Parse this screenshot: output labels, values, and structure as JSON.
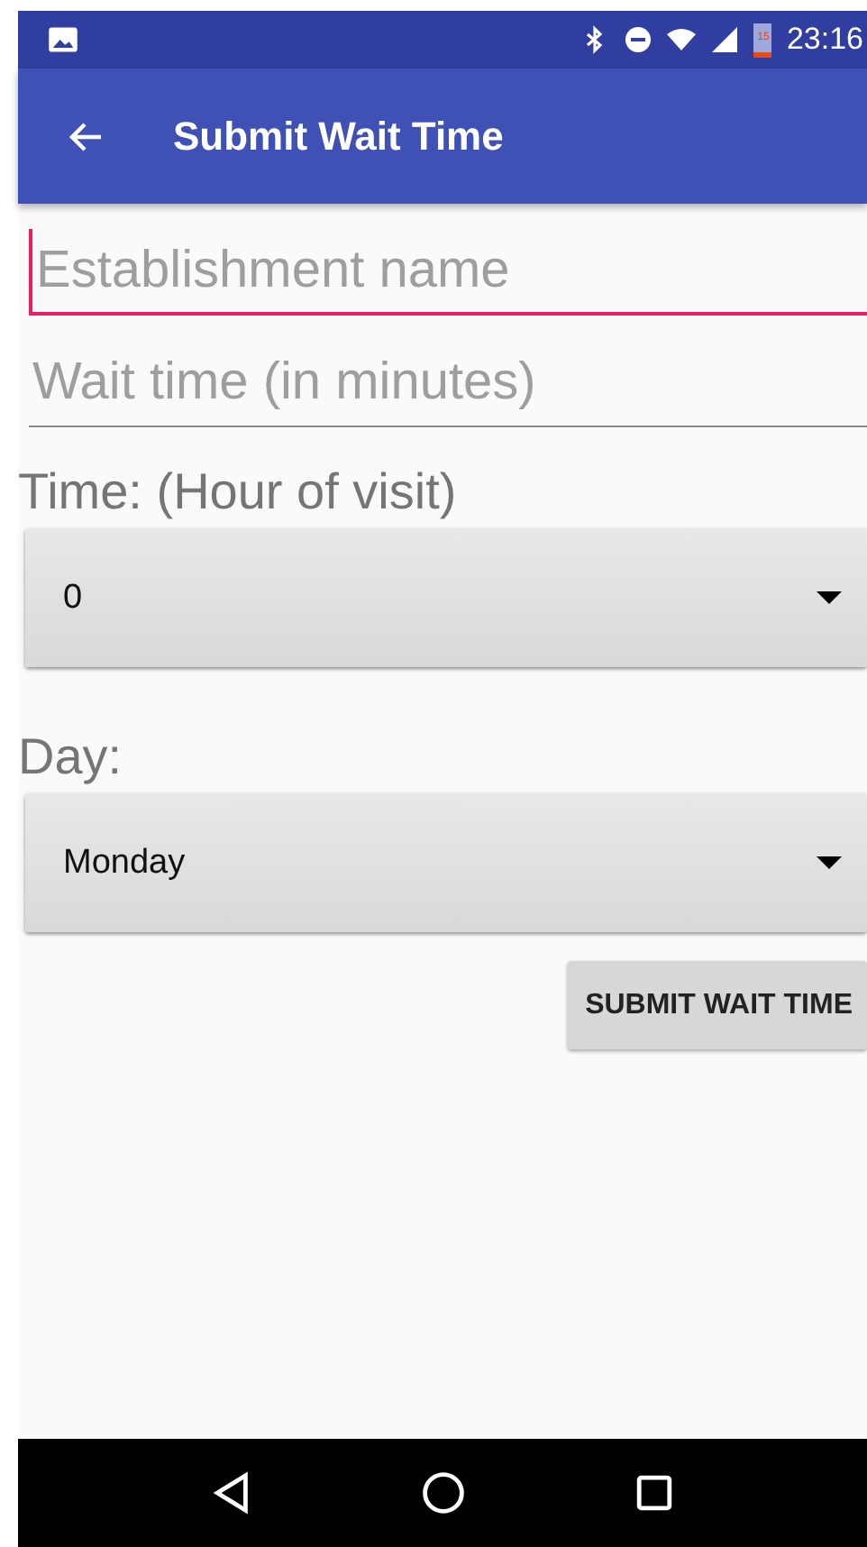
{
  "status_bar": {
    "battery_text": "15",
    "time": "23:16"
  },
  "toolbar": {
    "title": "Submit Wait Time"
  },
  "fields": [
    {
      "placeholder": "Establishment name",
      "focused": true
    },
    {
      "placeholder": "Wait time (in minutes)",
      "focused": false
    }
  ],
  "selects": [
    {
      "label": "Time: (Hour of visit)",
      "value": "0"
    },
    {
      "label": "Day:",
      "value": "Monday"
    }
  ],
  "submit_button": "SUBMIT WAIT TIME"
}
